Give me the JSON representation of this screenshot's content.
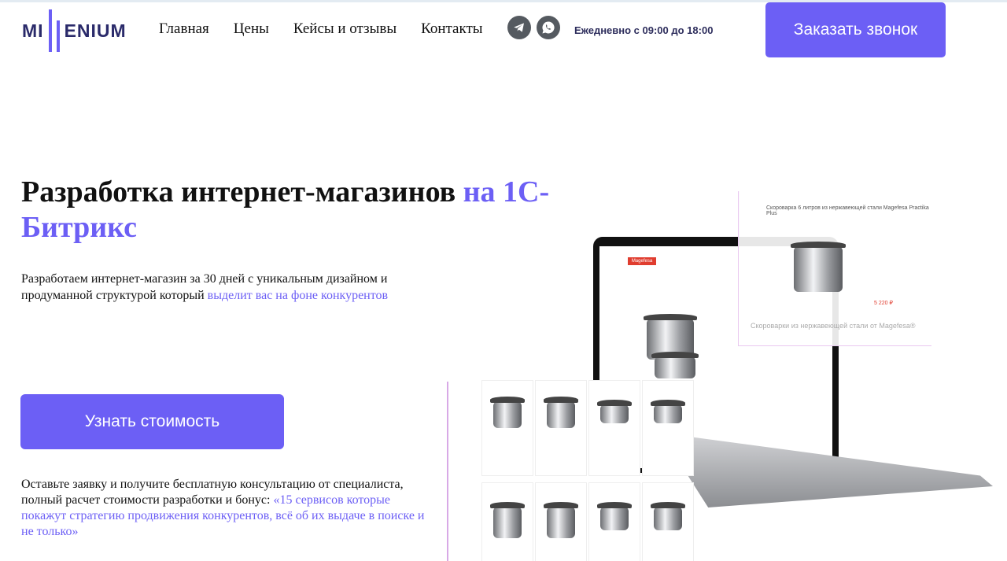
{
  "header": {
    "logo_left": "MI",
    "logo_right": "ENIUM",
    "nav": [
      "Главная",
      "Цены",
      "Кейсы и отзывы",
      "Контакты"
    ],
    "social": [
      {
        "icon": "telegram-icon",
        "color": "#555a60"
      },
      {
        "icon": "whatsapp-icon",
        "color": "#555a60"
      }
    ],
    "hours": "Ежедневно с 09:00 до 18:00",
    "call_button": "Заказать звонок"
  },
  "hero": {
    "title_main": "Разработка интернет-магазинов ",
    "title_accent": "на 1С-Битрикс",
    "lead_text": "Разработаем интернет-магазин за 30 дней с уникальным дизайном и продуманной структурой который ",
    "lead_accent": "выделит вас на фоне конкурентов",
    "price_button": "Узнать стоимость",
    "note_text": "Оставьте заявку и получите бесплатную консультацию от специалиста, полный расчет стоимости разработки и бонус: ",
    "note_accent": "«15 сервисов которые покажут стратегию продвижения конкурентов, всё об их выдаче в поиске и не только»"
  },
  "illustration": {
    "panel_title": "Скороварка 6 литров из нержавеющей стали Magefesa Practika Plus",
    "panel_text": "Скороварки из нержавеющей стали от Magefesa®",
    "screen_brand": "Magefesa",
    "product_price": "5 220 ₽"
  },
  "colors": {
    "accent": "#6c5ff5",
    "text": "#111111",
    "logo": "#2a2a6a"
  }
}
